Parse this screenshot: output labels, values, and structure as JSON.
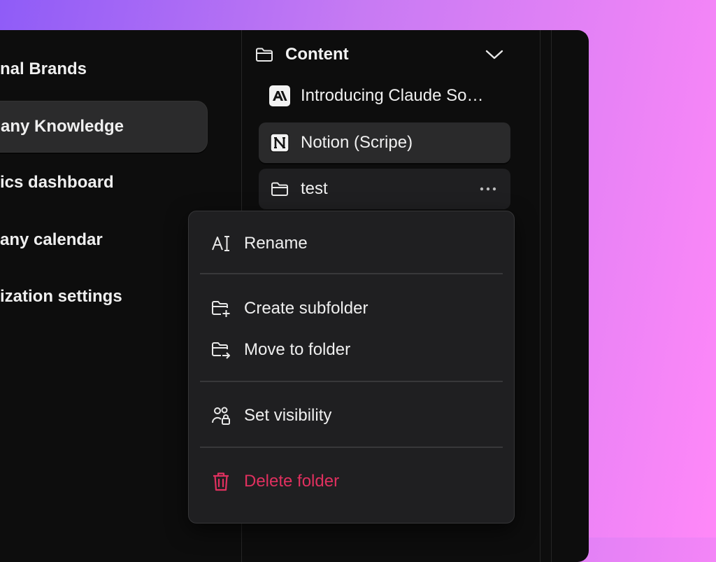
{
  "sidebar": {
    "items": [
      {
        "label": "nal Brands"
      },
      {
        "label": "any Knowledge"
      },
      {
        "label": "ics dashboard"
      },
      {
        "label": "any calendar"
      },
      {
        "label": "ization settings"
      }
    ],
    "active_index": 1
  },
  "tree": {
    "section_title": "Content",
    "section_icon": "folder-icon",
    "collapse_icon": "chevron-down-icon",
    "items": [
      {
        "label": "Introducing Claude So…",
        "icon": "anthropic-logo-icon"
      },
      {
        "label": "Notion (Scripe)",
        "icon": "notion-logo-icon"
      },
      {
        "label": "test",
        "icon": "folder-icon",
        "more_icon": "more-horizontal-icon"
      }
    ]
  },
  "context_menu": {
    "items": [
      {
        "label": "Rename",
        "icon": "rename-text-icon"
      },
      {
        "label": "Create subfolder",
        "icon": "folder-plus-icon"
      },
      {
        "label": "Move to folder",
        "icon": "folder-move-icon"
      },
      {
        "label": "Set visibility",
        "icon": "users-lock-icon"
      },
      {
        "label": "Delete folder",
        "icon": "trash-icon",
        "color": "#e0305f"
      }
    ]
  },
  "colors": {
    "background_gradient_start": "#8f5cf7",
    "background_gradient_end": "#ff88f8",
    "window": "#0d0d0d",
    "menu": "#1f1f21",
    "danger": "#e0305f"
  }
}
